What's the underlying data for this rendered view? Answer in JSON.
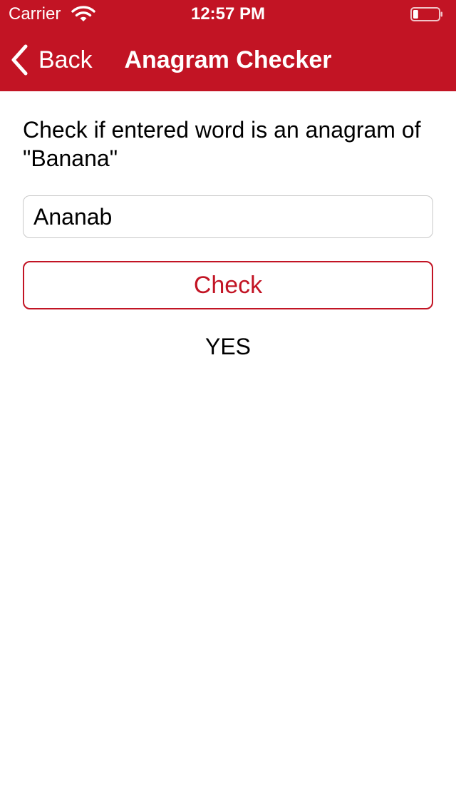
{
  "status_bar": {
    "carrier": "Carrier",
    "time": "12:57 PM",
    "wifi_icon": "wifi-icon",
    "battery_icon": "battery-low-icon",
    "battery_level": 0.2
  },
  "nav": {
    "back_label": "Back",
    "back_icon": "chevron-left-icon",
    "title": "Anagram Checker"
  },
  "main": {
    "prompt": "Check if entered word is an anagram of \"Banana\"",
    "word_value": "Ananab",
    "check_label": "Check",
    "result": "YES"
  },
  "colors": {
    "brand": "#c21424",
    "background": "#ffffff",
    "text": "#000000",
    "input_border": "#c8c8c8"
  }
}
